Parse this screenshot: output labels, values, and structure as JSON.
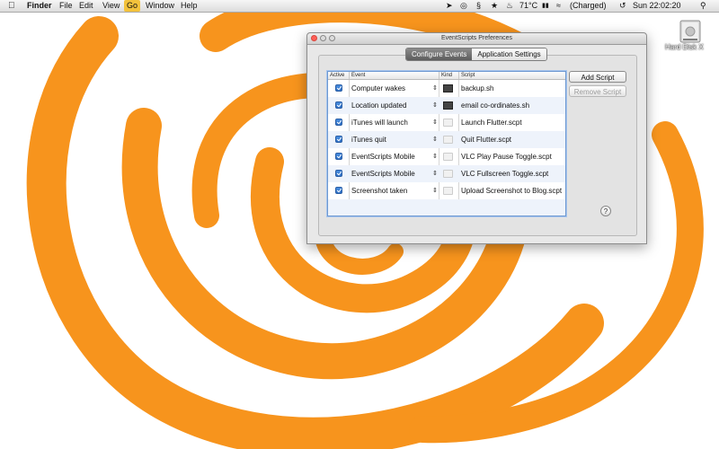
{
  "menubar": {
    "apple_icon": "apple-icon",
    "items": [
      "Finder",
      "File",
      "Edit",
      "View",
      "Go",
      "Window",
      "Help"
    ],
    "active_item": "Go",
    "tray": {
      "temperature": "71°C",
      "battery": "(Charged)",
      "clock": "Sun 22:02:20"
    }
  },
  "desktop": {
    "accent": "#f7941d",
    "hd_label": "Hard Disk X"
  },
  "window": {
    "title": "EventScripts Preferences",
    "tabs": [
      {
        "label": "Configure Events",
        "selected": true
      },
      {
        "label": "Application Settings",
        "selected": false
      }
    ],
    "columns": {
      "active": "Active",
      "event": "Event",
      "kind": "Kind",
      "script": "Script"
    },
    "rows": [
      {
        "active": true,
        "event": "Computer wakes",
        "kind": "terminal",
        "script": "backup.sh"
      },
      {
        "active": true,
        "event": "Location updated",
        "kind": "terminal",
        "script": "email co-ordinates.sh"
      },
      {
        "active": true,
        "event": "iTunes will launch",
        "kind": "applescript",
        "script": "Launch Flutter.scpt"
      },
      {
        "active": true,
        "event": "iTunes quit",
        "kind": "applescript",
        "script": "Quit Flutter.scpt"
      },
      {
        "active": true,
        "event": "EventScripts Mobile",
        "kind": "applescript",
        "script": "VLC Play Pause Toggle.scpt"
      },
      {
        "active": true,
        "event": "EventScripts Mobile",
        "kind": "applescript",
        "script": "VLC Fullscreen Toggle.scpt"
      },
      {
        "active": true,
        "event": "Screenshot taken",
        "kind": "applescript",
        "script": "Upload Screenshot to Blog.scpt"
      }
    ],
    "buttons": {
      "add": "Add Script",
      "remove": "Remove Script",
      "help": "?"
    }
  }
}
